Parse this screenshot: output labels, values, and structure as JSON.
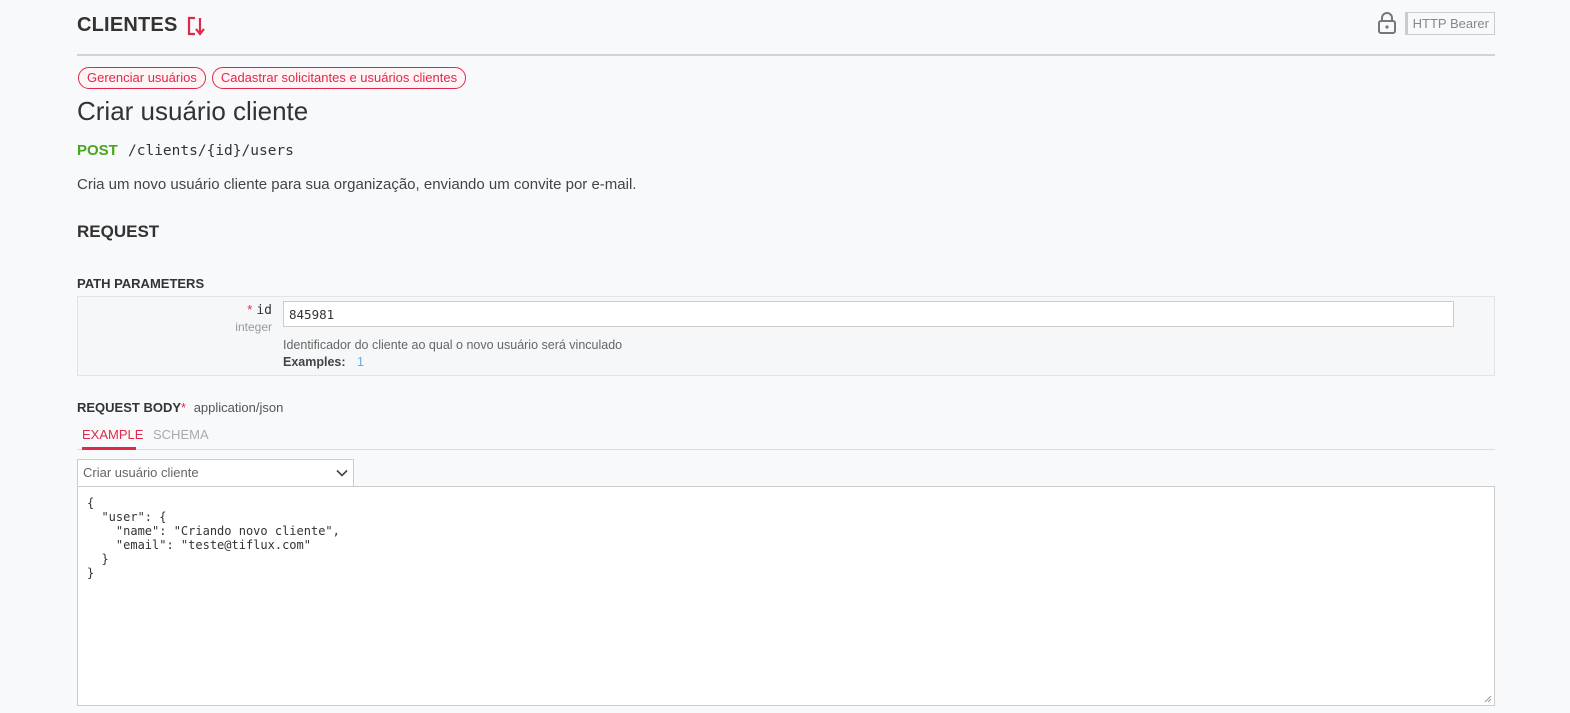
{
  "header": {
    "section_title": "CLIENTES",
    "auth_label": "HTTP Bearer"
  },
  "tags": [
    "Gerenciar usuários",
    "Cadastrar solicitantes e usuários clientes"
  ],
  "operation": {
    "title": "Criar usuário cliente",
    "method": "POST",
    "path": "/clients/{id}/users",
    "description": "Cria um novo usuário cliente para sua organização, enviando um convite por e-mail."
  },
  "request": {
    "heading": "REQUEST",
    "path_params_heading": "PATH PARAMETERS",
    "param": {
      "required_mark": "*",
      "name": "id",
      "type": "integer",
      "value": "845981",
      "description": "Identificador do cliente ao qual o novo usuário será vinculado",
      "examples_label": "Examples:",
      "example_value": "1"
    },
    "body": {
      "heading": "REQUEST BODY",
      "required_mark": "*",
      "content_type": "application/json",
      "tabs": [
        "EXAMPLE",
        "SCHEMA"
      ],
      "example_select": "Criar usuário cliente",
      "example_json": "{\n  \"user\": {\n    \"name\": \"Criando novo cliente\",\n    \"email\": \"teste@tiflux.com\"\n  }\n}"
    }
  },
  "colors": {
    "accent": "#e0294a",
    "post": "#49a51d",
    "example_link": "#59b0e8"
  }
}
